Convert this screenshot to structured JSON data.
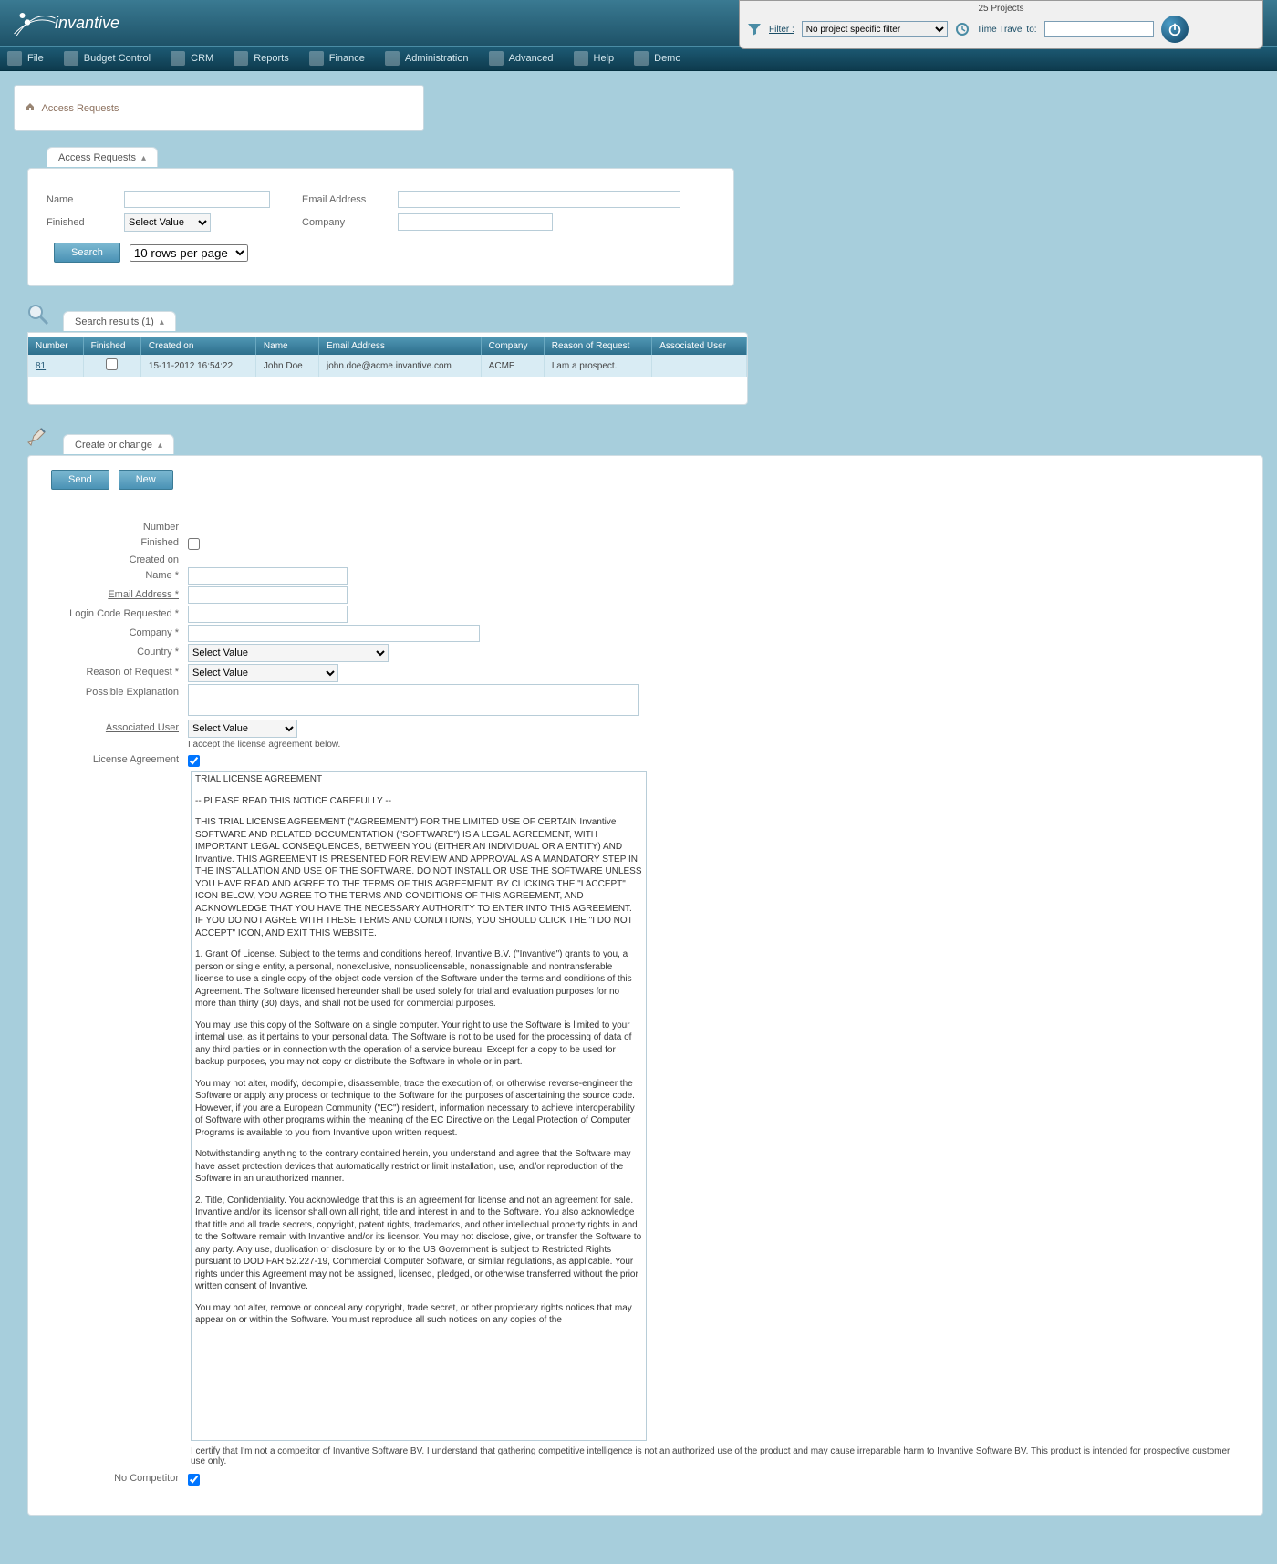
{
  "header": {
    "logo": "invantive",
    "projects_count": "25 Projects",
    "filter_label": "Filter :",
    "filter_value": "No project specific filter",
    "time_travel_label": "Time Travel to:",
    "time_travel_value": ""
  },
  "menu": [
    "File",
    "Budget Control",
    "CRM",
    "Reports",
    "Finance",
    "Administration",
    "Advanced",
    "Help",
    "Demo"
  ],
  "breadcrumb": "Access Requests",
  "search": {
    "tab": "Access Requests",
    "name_label": "Name",
    "name_value": "",
    "email_label": "Email Address",
    "email_value": "",
    "finished_label": "Finished",
    "finished_value": "Select Value",
    "company_label": "Company",
    "company_value": "",
    "search_btn": "Search",
    "rows_per_page": "10 rows per page"
  },
  "results": {
    "tab": "Search results (1)",
    "cols": [
      "Number",
      "Finished",
      "Created on",
      "Name",
      "Email Address",
      "Company",
      "Reason of Request",
      "Associated User"
    ],
    "row": {
      "number": "81",
      "finished": false,
      "created_on": "15-11-2012 16:54:22",
      "name": "John Doe",
      "email": "john.doe@acme.invantive.com",
      "company": "ACME",
      "reason": "I am a prospect.",
      "user": ""
    }
  },
  "form": {
    "tab": "Create or change",
    "send_btn": "Send",
    "new_btn": "New",
    "number_label": "Number",
    "finished_label": "Finished",
    "created_on_label": "Created on",
    "name_label": "Name *",
    "email_label": "Email Address *",
    "login_label": "Login Code Requested *",
    "company_label": "Company *",
    "country_label": "Country *",
    "country_value": "Select Value",
    "reason_label": "Reason of Request *",
    "reason_value": "Select Value",
    "explanation_label": "Possible Explanation",
    "assoc_user_label": "Associated User",
    "assoc_user_value": "Select Value",
    "accept_note": "I accept the license agreement below.",
    "license_label": "License Agreement",
    "license_p1": "TRIAL LICENSE AGREEMENT",
    "license_p2": "-- PLEASE READ THIS NOTICE CAREFULLY --",
    "license_p3": "THIS TRIAL LICENSE AGREEMENT (\"AGREEMENT\") FOR THE LIMITED USE OF CERTAIN Invantive SOFTWARE AND RELATED DOCUMENTATION (\"SOFTWARE\") IS A LEGAL AGREEMENT, WITH IMPORTANT LEGAL CONSEQUENCES, BETWEEN YOU (EITHER AN INDIVIDUAL OR A ENTITY) AND Invantive.  THIS AGREEMENT IS PRESENTED FOR REVIEW AND APPROVAL AS A MANDATORY STEP IN THE INSTALLATION AND USE OF THE SOFTWARE.  DO NOT INSTALL OR USE THE SOFTWARE UNLESS YOU HAVE READ AND AGREE TO THE TERMS OF THIS AGREEMENT.  BY CLICKING THE \"I ACCEPT\" ICON BELOW, YOU AGREE TO THE TERMS AND CONDITIONS OF THIS AGREEMENT, AND ACKNOWLEDGE THAT YOU HAVE THE NECESSARY AUTHORITY TO ENTER INTO THIS AGREEMENT.  IF YOU DO NOT AGREE WITH THESE TERMS AND CONDITIONS, YOU SHOULD CLICK THE \"I DO NOT ACCEPT\" ICON, AND EXIT THIS WEBSITE.",
    "license_p4": "1.  Grant Of License.  Subject to the terms and conditions hereof, Invantive B.V. (\"Invantive\") grants to you, a person or single entity, a personal, nonexclusive, nonsublicensable, nonassignable and nontransferable license to use a single copy of the object code version of the Software under the terms and conditions of this Agreement. The Software licensed hereunder shall be used solely for trial and evaluation purposes for no more than thirty (30) days, and shall not be used for commercial purposes.",
    "license_p5": "You may use this copy of the Software on a single computer.  Your right to use the Software is limited to your internal use, as it pertains to your personal data.  The Software is not to be used for the processing of data of any third parties or in connection with the operation of a service bureau.  Except for a copy to be used for backup purposes, you may not copy or distribute the Software in whole or in part.",
    "license_p6": "You may not alter, modify, decompile, disassemble, trace the execution of, or otherwise reverse-engineer the Software or apply any process or technique to the Software for the purposes of ascertaining the source code.  However, if you are a European Community (\"EC\") resident, information necessary to achieve interoperability of Software with other programs within the meaning of the EC Directive on the Legal Protection of Computer Programs is available to you from Invantive upon written request.",
    "license_p7": "Notwithstanding anything to the contrary contained herein, you understand and agree that the Software may have asset protection devices that automatically restrict or limit installation, use, and/or reproduction of the Software in an unauthorized manner.",
    "license_p8": "2.  Title, Confidentiality. You acknowledge that this is an agreement for license and not an agreement for sale.  Invantive and/or its licensor shall own all right, title and interest in and to the Software.  You also acknowledge that title and all trade secrets, copyright, patent rights, trademarks, and other intellectual property rights in and to the Software remain with Invantive and/or its licensor.  You may not disclose, give, or transfer the Software to any party.  Any use, duplication or disclosure by or to the US Government is subject to Restricted Rights pursuant to DOD FAR 52.227-19, Commercial Computer Software, or similar regulations, as applicable.  Your rights under this Agreement may not be assigned, licensed, pledged, or otherwise transferred without the prior written consent of Invantive.",
    "license_p9": "You may not alter, remove or conceal any copyright, trade secret, or other proprietary rights notices that may appear on or within the Software.  You must reproduce all such notices on any copies of the",
    "cert_text": "I certify that I'm not a competitor of Invantive Software BV. I understand that gathering competitive intelligence is not an authorized use of the product and may cause irreparable harm to Invantive Software BV. This product is intended for prospective customer use only.",
    "no_comp_label": "No Competitor"
  }
}
